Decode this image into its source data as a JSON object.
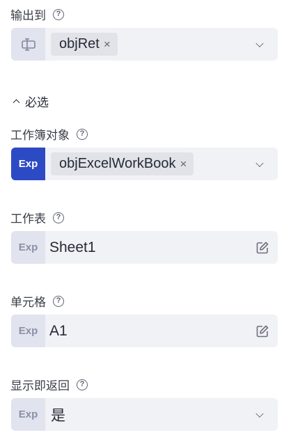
{
  "output": {
    "label": "输出到",
    "tag": "objRet"
  },
  "section": {
    "label": "必选"
  },
  "workbook": {
    "label": "工作簿对象",
    "prefix": "Exp",
    "tag": "objExcelWorkBook"
  },
  "sheet": {
    "label": "工作表",
    "prefix": "Exp",
    "value": "Sheet1"
  },
  "cell": {
    "label": "单元格",
    "prefix": "Exp",
    "value": "A1"
  },
  "show_return": {
    "label": "显示即返回",
    "prefix": "Exp",
    "value": "是"
  },
  "icons": {
    "help": "?",
    "close": "×"
  },
  "colors": {
    "accent": "#2d4ac5",
    "field_bg": "#f1f2f6",
    "prefix_bg": "#e1e3ee"
  }
}
